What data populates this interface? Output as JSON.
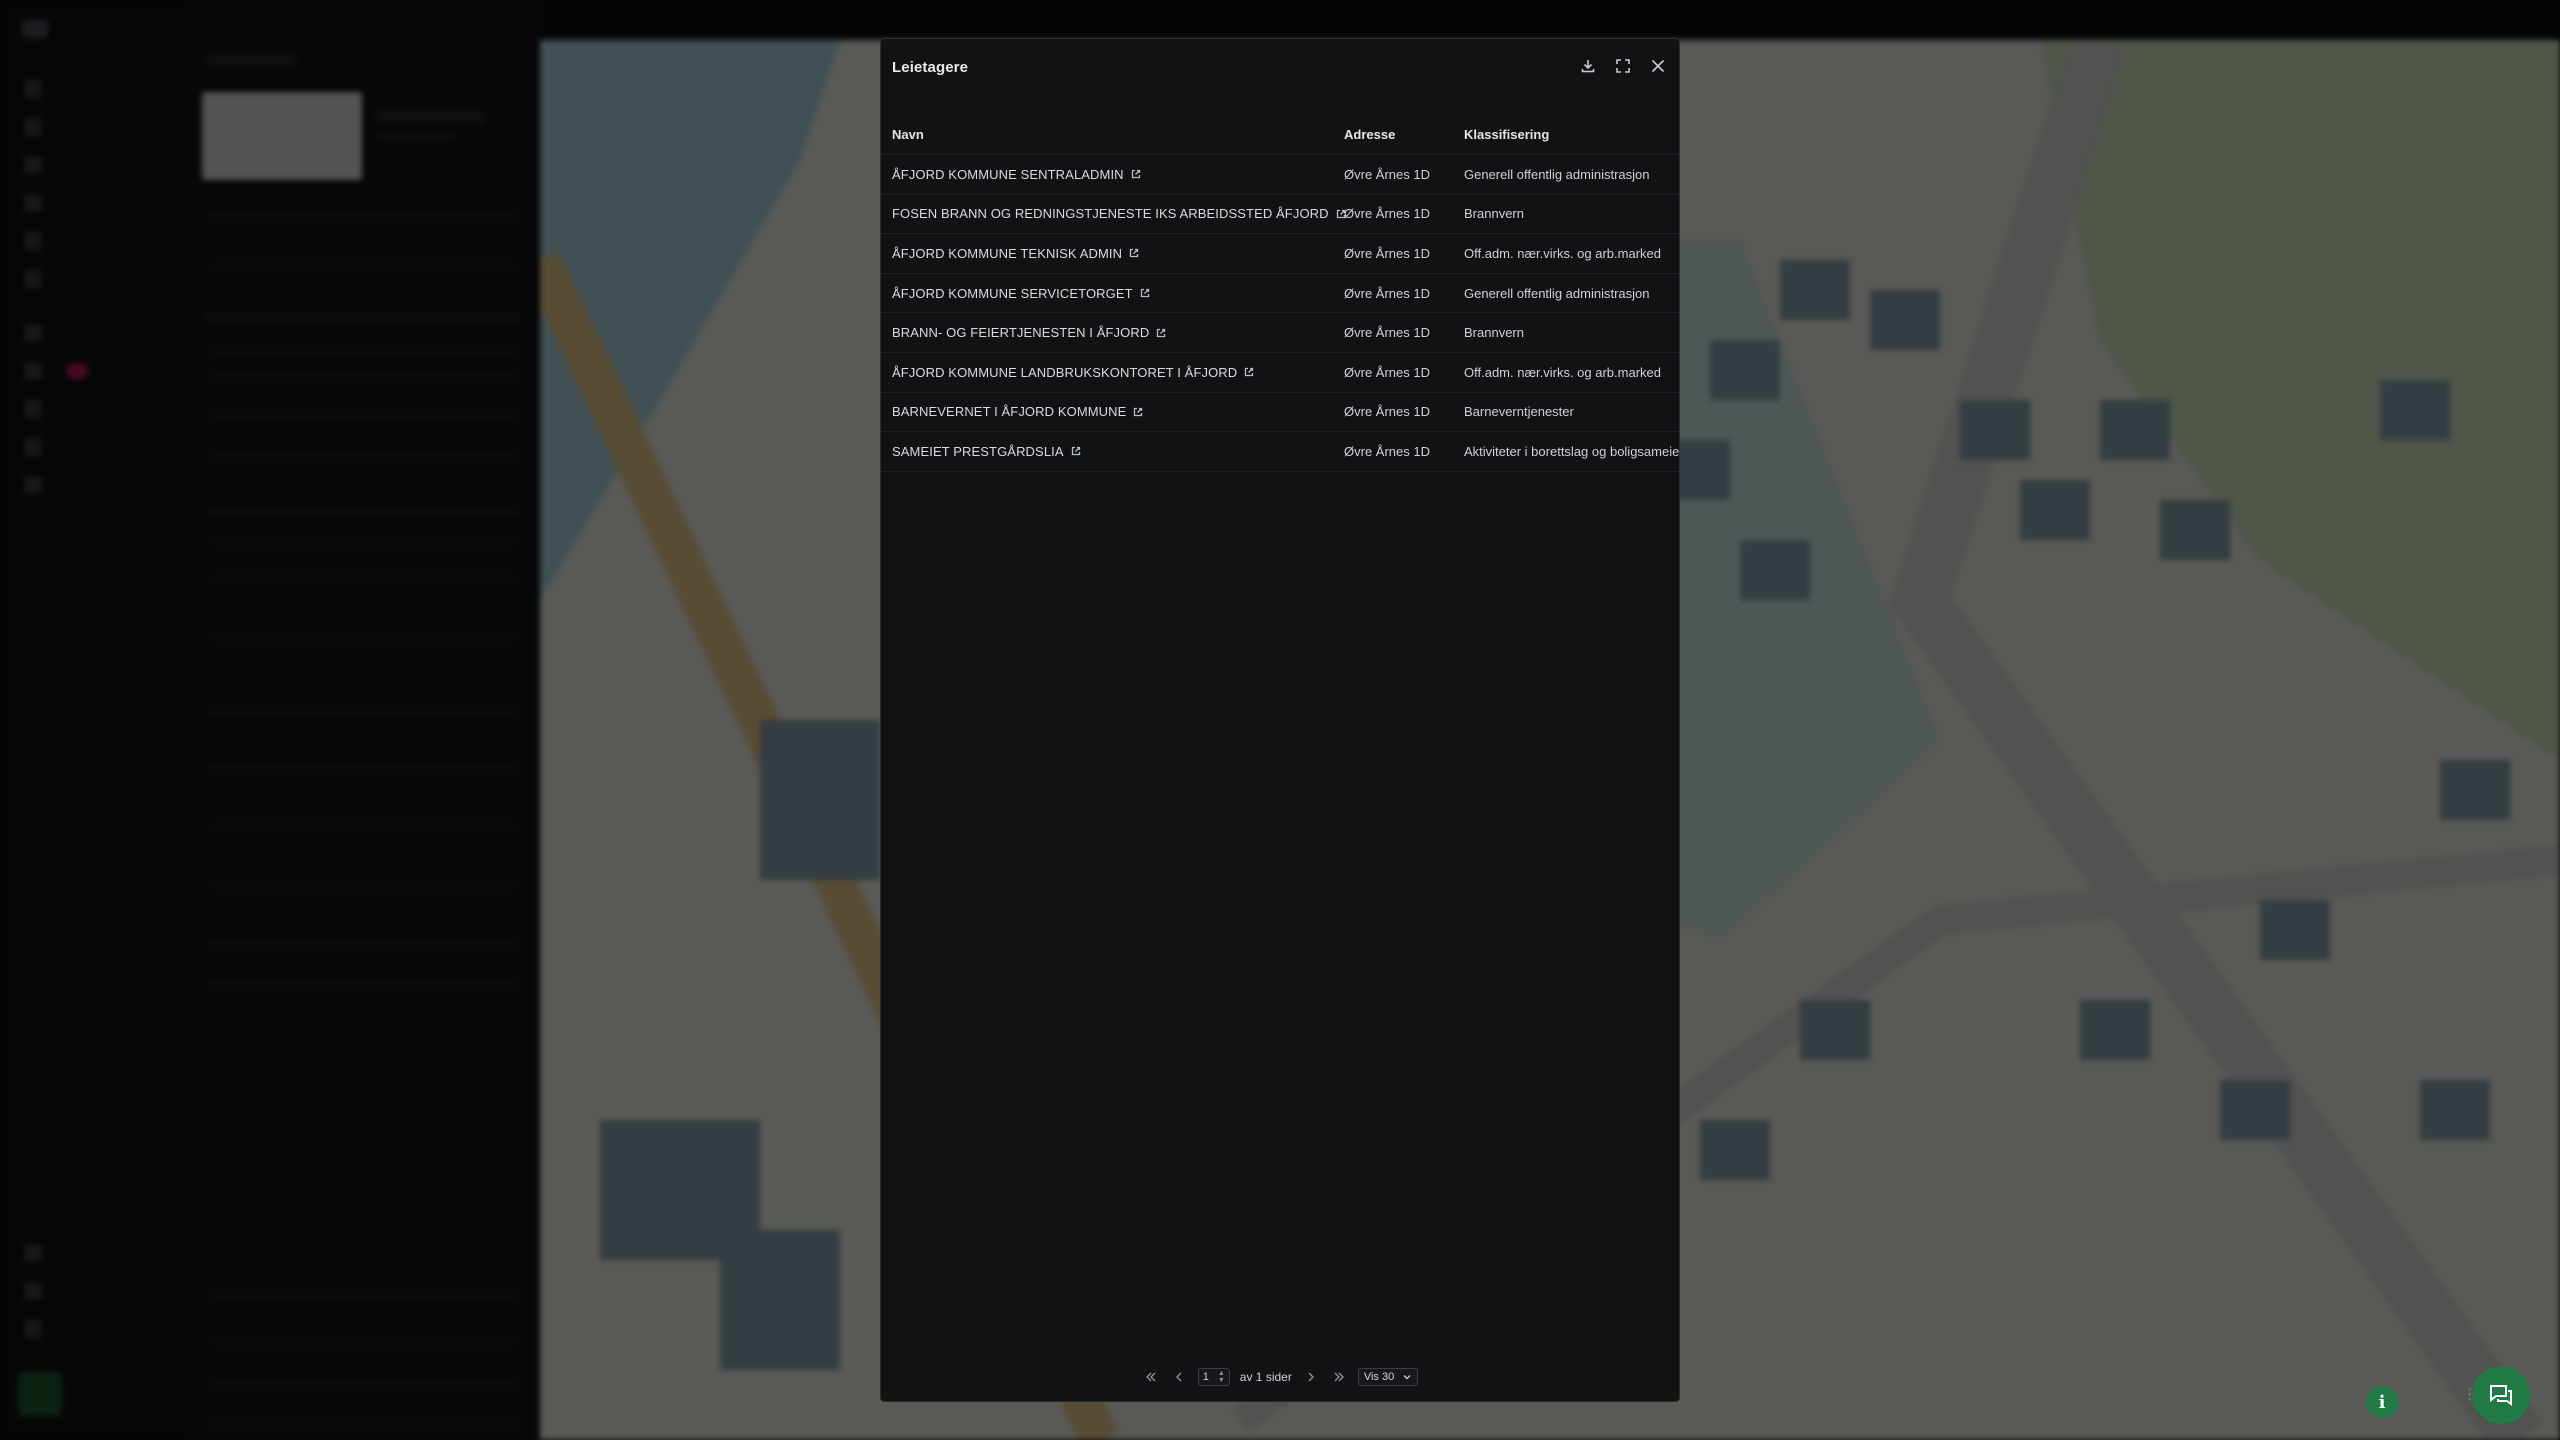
{
  "modal": {
    "title": "Leietagere",
    "columns": {
      "name": "Navn",
      "address": "Adresse",
      "classification": "Klassifisering"
    },
    "rows": [
      {
        "name": "ÅFJORD KOMMUNE SENTRALADMIN",
        "address": "Øvre Årnes 1D",
        "classification": "Generell offentlig administrasjon"
      },
      {
        "name": "FOSEN BRANN OG REDNINGSTJENESTE IKS ARBEIDSSTED ÅFJORD",
        "address": "Øvre Årnes 1D",
        "classification": "Brannvern"
      },
      {
        "name": "ÅFJORD KOMMUNE TEKNISK ADMIN",
        "address": "Øvre Årnes 1D",
        "classification": "Off.adm. nær.virks. og arb.marked"
      },
      {
        "name": "ÅFJORD KOMMUNE SERVICETORGET",
        "address": "Øvre Årnes 1D",
        "classification": "Generell offentlig administrasjon"
      },
      {
        "name": "BRANN- OG FEIERTJENESTEN I ÅFJORD",
        "address": "Øvre Årnes 1D",
        "classification": "Brannvern"
      },
      {
        "name": "ÅFJORD KOMMUNE LANDBRUKSKONTORET I ÅFJORD",
        "address": "Øvre Årnes 1D",
        "classification": "Off.adm. nær.virks. og arb.marked"
      },
      {
        "name": "BARNEVERNET I ÅFJORD KOMMUNE",
        "address": "Øvre Årnes 1D",
        "classification": "Barneverntjenester"
      },
      {
        "name": "SAMEIET PRESTGÅRDSLIA",
        "address": "Øvre Årnes 1D",
        "classification": "Aktiviteter i borettslag og boligsameier"
      }
    ],
    "pagination": {
      "page": "1",
      "of_pages": "av 1 sider",
      "page_size": "Vis 30"
    }
  },
  "icons": {
    "download": "download-icon",
    "expand": "expand-icon",
    "close": "close-icon",
    "external": "external-link-icon",
    "first": "first-page-icon",
    "prev": "prev-page-icon",
    "next": "next-page-icon",
    "last": "last-page-icon",
    "chevron": "chevron-down-icon",
    "info": "info-icon",
    "chat": "chat-icon"
  },
  "colors": {
    "accent": "#1f7a43",
    "modal_bg": "#111214"
  }
}
